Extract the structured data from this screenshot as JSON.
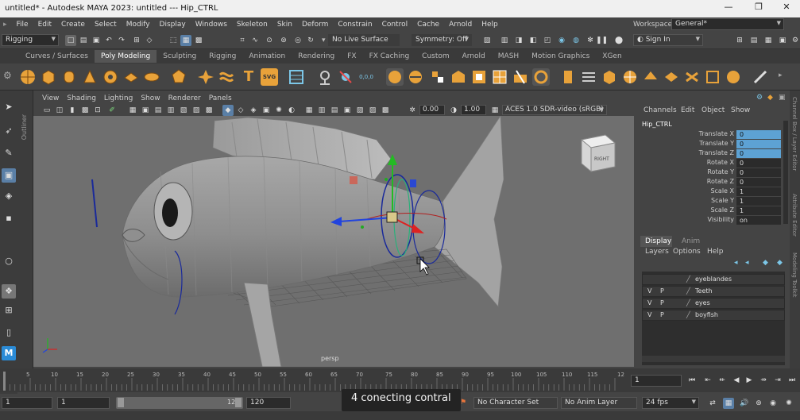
{
  "window": {
    "title": "untitled* - Autodesk MAYA 2023: untitled   ---   Hip_CTRL",
    "controls": [
      "—",
      "❐",
      "✕"
    ]
  },
  "menubar": {
    "items": [
      "File",
      "Edit",
      "Create",
      "Select",
      "Modify",
      "Display",
      "Windows",
      "Skeleton",
      "Skin",
      "Deform",
      "Constrain",
      "Control",
      "Cache",
      "Arnold",
      "Help"
    ],
    "workspace_label": "Workspace:",
    "workspace_value": "General*"
  },
  "statusline": {
    "menuset": "Rigging",
    "live_surface": "No Live Surface",
    "symmetry": "Symmetry: Off",
    "sign_in": "Sign In"
  },
  "shelf": {
    "tabs": [
      "Curves / Surfaces",
      "Poly Modeling",
      "Sculpting",
      "Rigging",
      "Animation",
      "Rendering",
      "FX",
      "FX Caching",
      "Custom",
      "Arnold",
      "MASH",
      "Motion Graphics",
      "XGen"
    ],
    "active_tab": "Poly Modeling"
  },
  "panel": {
    "menus": [
      "View",
      "Shading",
      "Lighting",
      "Show",
      "Renderer",
      "Panels"
    ],
    "exposure": "0.00",
    "gamma": "1.00",
    "colorspace": "ACES 1.0 SDR-video (sRGB)",
    "camera": "persp",
    "viewcube": "RIGHT"
  },
  "outliner": {
    "label": "Outliner"
  },
  "channelbox": {
    "tabs": [
      "Channels",
      "Edit",
      "Object",
      "Show"
    ],
    "object": "Hip_CTRL",
    "channels": [
      {
        "name": "Translate X",
        "value": "0"
      },
      {
        "name": "Translate Y",
        "value": "0"
      },
      {
        "name": "Translate Z",
        "value": "0"
      },
      {
        "name": "Rotate X",
        "value": "0"
      },
      {
        "name": "Rotate Y",
        "value": "0"
      },
      {
        "name": "Rotate Z",
        "value": "0"
      },
      {
        "name": "Scale X",
        "value": "1"
      },
      {
        "name": "Scale Y",
        "value": "1"
      },
      {
        "name": "Scale Z",
        "value": "1"
      },
      {
        "name": "Visibility",
        "value": "on"
      }
    ],
    "highlighted_count": 3
  },
  "layers": {
    "tabs": [
      "Display",
      "Anim"
    ],
    "menus": [
      "Layers",
      "Options",
      "Help"
    ],
    "rows": [
      {
        "v": "",
        "p": "",
        "name": "eyeblandes"
      },
      {
        "v": "V",
        "p": "P",
        "name": "Teeth"
      },
      {
        "v": "V",
        "p": "P",
        "name": "eyes"
      },
      {
        "v": "V",
        "p": "P",
        "name": "boyfish"
      }
    ]
  },
  "side_tabs": [
    "Channel Box / Layer Editor",
    "Attribute Editor",
    "Modeling Toolkit"
  ],
  "timeline": {
    "ticks": [
      "5",
      "10",
      "15",
      "20",
      "25",
      "30",
      "35",
      "40",
      "45",
      "50",
      "55",
      "60",
      "65",
      "70",
      "75",
      "80",
      "85",
      "90",
      "95",
      "100",
      "105",
      "110",
      "115",
      "12"
    ],
    "current_frame": "1"
  },
  "range": {
    "start": "1",
    "start_inner": "1",
    "end_inner": "120",
    "end": "120",
    "character_set": "No Character Set",
    "anim_layer": "No Anim Layer",
    "fps": "24 fps"
  },
  "caption": "4 conecting contral",
  "colors": {
    "accent": "#5da2d4",
    "viewport_bg": "#6f6f6f"
  }
}
